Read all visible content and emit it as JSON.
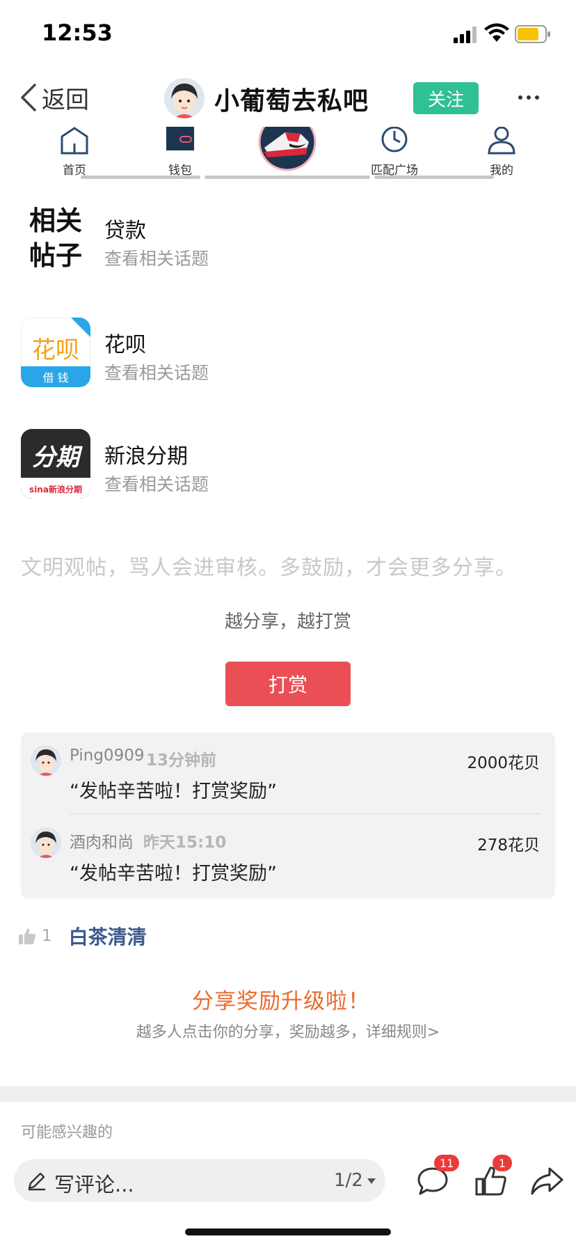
{
  "status_bar": {
    "time": "12:53"
  },
  "nav": {
    "back_label": "返回",
    "title": "小葡萄去私吧",
    "follow_label": "关注"
  },
  "tabs": [
    {
      "label": "首页",
      "icon": "home-icon"
    },
    {
      "label": "钱包",
      "icon": "wallet-icon"
    },
    {
      "label": "",
      "icon": "sneaker-thumbnail"
    },
    {
      "label": "匹配广场",
      "icon": "match-icon"
    },
    {
      "label": "我的",
      "icon": "profile-icon"
    }
  ],
  "related": {
    "header": "相关帖子",
    "items": [
      {
        "title": "贷款",
        "sub": "查看相关话题"
      },
      {
        "title": "花呗",
        "sub": "查看相关话题",
        "logo_text": "花呗",
        "logo_caption": "借 钱"
      },
      {
        "title": "新浪分期",
        "sub": "查看相关话题",
        "logo_text": "分期",
        "logo_caption": "sina新浪分期"
      }
    ]
  },
  "notice": "文明观帖，骂人会进审核。多鼓励，才会更多分享。",
  "tip": {
    "heading": "越分享，越打赏",
    "button": "打赏"
  },
  "rewards": [
    {
      "name": "Ping0909",
      "time": "13分钟前",
      "amount": "2000花贝",
      "message": "“发帖辛苦啦！打赏奖励”"
    },
    {
      "name": "酒肉和尚",
      "time": "昨天15:10",
      "amount": "278花贝",
      "message": "“发帖辛苦啦！打赏奖励”"
    }
  ],
  "likes": {
    "count": "1",
    "user": "白茶清清"
  },
  "share": {
    "title": "分享奖励升级啦！",
    "sub": "越多人点击你的分享，奖励越多，详细规则>"
  },
  "maybe_interested": "可能感兴趣的",
  "bottom_bar": {
    "comment_placeholder": "写评论...",
    "page": "1/2",
    "comment_badge": "11",
    "like_badge": "1"
  },
  "colors": {
    "follow": "#2fc095",
    "reward_button": "#e94f54",
    "share_title": "#ed6a2c",
    "like_user": "#3a5a8c",
    "badge": "#ea3b3b"
  }
}
